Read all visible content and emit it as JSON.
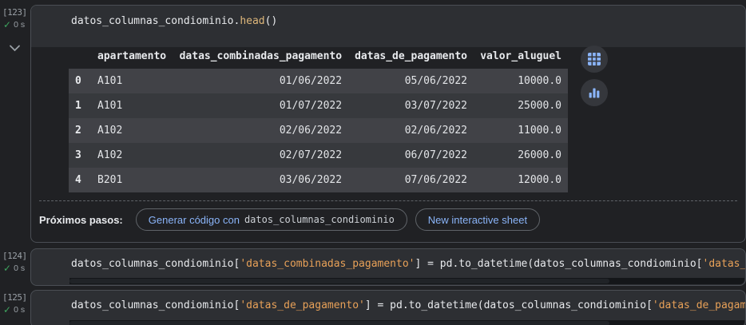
{
  "colors": {
    "page_bg": "#202124",
    "cell_bg": "#2d2f33",
    "accent_blue": "#8ab4f8",
    "string_orange": "#e8a158",
    "function_gold": "#ddb67a",
    "check_green": "#3fa55f",
    "row_stripe_light": "#414247",
    "row_stripe_dark": "#37393d"
  },
  "icons": {
    "check": "✓"
  },
  "cells": [
    {
      "execution_count": "[123]",
      "time": "0 s",
      "tokens": [
        {
          "text": "datos_columnas_condiominio.",
          "style": "plain"
        },
        {
          "text": "head",
          "style": "function"
        },
        {
          "text": "()",
          "style": "plain"
        }
      ]
    },
    {
      "execution_count": "[124]",
      "time": "0 s",
      "tokens": [
        {
          "text": "datos_columnas_condiominio[",
          "style": "plain"
        },
        {
          "text": "'datas_combinadas_pagamento'",
          "style": "string"
        },
        {
          "text": "] = pd.to_datetime(datos_columnas_condiominio[",
          "style": "plain"
        },
        {
          "text": "'datas_",
          "style": "string"
        }
      ]
    },
    {
      "execution_count": "[125]",
      "time": "0 s",
      "tokens": [
        {
          "text": "datos_columnas_condiominio[",
          "style": "plain"
        },
        {
          "text": "'datas_de_pagamento'",
          "style": "string"
        },
        {
          "text": "] = pd.to_datetime(datos_columnas_condiominio[",
          "style": "plain"
        },
        {
          "text": "'datas_de_pagam",
          "style": "string"
        }
      ]
    }
  ],
  "output_table": {
    "headers": [
      "",
      "apartamento",
      "datas_combinadas_pagamento",
      "datas_de_pagamento",
      "valor_aluguel"
    ],
    "rows": [
      [
        "0",
        "A101",
        "01/06/2022",
        "05/06/2022",
        "10000.0"
      ],
      [
        "1",
        "A101",
        "01/07/2022",
        "03/07/2022",
        "25000.0"
      ],
      [
        "2",
        "A102",
        "02/06/2022",
        "02/06/2022",
        "11000.0"
      ],
      [
        "3",
        "A102",
        "02/07/2022",
        "06/07/2022",
        "26000.0"
      ],
      [
        "4",
        "B201",
        "03/06/2022",
        "07/06/2022",
        "12000.0"
      ]
    ]
  },
  "next_steps": {
    "label": "Próximos pasos:",
    "generate_button": {
      "prefix": "Generar código con",
      "code": "datos_columnas_condiominio"
    },
    "sheet_button_label": "New interactive sheet"
  }
}
